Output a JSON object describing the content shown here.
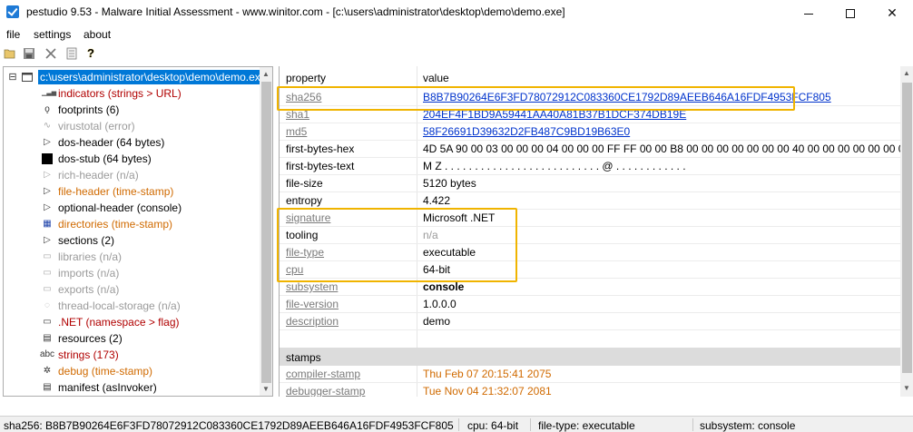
{
  "window": {
    "title": "pestudio 9.53 - Malware Initial Assessment - www.winitor.com - [c:\\users\\administrator\\desktop\\demo\\demo.exe]",
    "controls": {
      "minimize": "—",
      "maximize": "☐",
      "close": "✕"
    }
  },
  "menu": [
    "file",
    "settings",
    "about"
  ],
  "toolbar": {
    "icons": [
      "open-folder-icon",
      "save-icon",
      "close-x-icon",
      "list-icon",
      "help-icon"
    ],
    "help_glyph": "?"
  },
  "tree": {
    "expander": "⊟",
    "root": "c:\\users\\administrator\\desktop\\demo\\demo.exe",
    "items": [
      {
        "label": "indicators (strings > URL)",
        "color": "red",
        "icon": "bar-chart-icon",
        "glyph": "▁▃▅"
      },
      {
        "label": "footprints (6)",
        "color": "black",
        "icon": "footprint-icon",
        "glyph": "ǫ"
      },
      {
        "label": "virustotal (error)",
        "color": "gray",
        "icon": "virustotal-icon",
        "glyph": "∿"
      },
      {
        "label": "dos-header (64 bytes)",
        "color": "black",
        "icon": "arrow-right-icon",
        "glyph": "▷"
      },
      {
        "label": "dos-stub (64 bytes)",
        "color": "black",
        "icon": "console-icon",
        "glyph": "▬"
      },
      {
        "label": "rich-header (n/a)",
        "color": "gray",
        "icon": "arrow-right-icon",
        "glyph": "▷"
      },
      {
        "label": "file-header (time-stamp)",
        "color": "orange",
        "icon": "arrow-right-icon",
        "glyph": "▷"
      },
      {
        "label": "optional-header (console)",
        "color": "black",
        "icon": "arrow-right-icon",
        "glyph": "▷"
      },
      {
        "label": "directories (time-stamp)",
        "color": "orange",
        "icon": "directories-icon",
        "glyph": "▦"
      },
      {
        "label": "sections (2)",
        "color": "black",
        "icon": "arrow-right-icon",
        "glyph": "▷"
      },
      {
        "label": "libraries (n/a)",
        "color": "gray",
        "icon": "library-icon",
        "glyph": "▭"
      },
      {
        "label": "imports (n/a)",
        "color": "gray",
        "icon": "imports-icon",
        "glyph": "▭"
      },
      {
        "label": "exports (n/a)",
        "color": "gray",
        "icon": "exports-icon",
        "glyph": "▭"
      },
      {
        "label": "thread-local-storage (n/a)",
        "color": "gray",
        "icon": "tls-icon",
        "glyph": "◌"
      },
      {
        "label": ".NET (namespace > flag)",
        "color": "red",
        "icon": "dotnet-icon",
        "glyph": "▭"
      },
      {
        "label": "resources (2)",
        "color": "black",
        "icon": "resources-icon",
        "glyph": "▤"
      },
      {
        "label": "strings (173)",
        "color": "red",
        "icon": "strings-icon",
        "glyph": "abc"
      },
      {
        "label": "debug (time-stamp)",
        "color": "orange",
        "icon": "debug-icon",
        "glyph": "✲"
      },
      {
        "label": "manifest (asInvoker)",
        "color": "black",
        "icon": "manifest-icon",
        "glyph": "▤"
      }
    ]
  },
  "properties": {
    "headers": {
      "property": "property",
      "value": "value"
    },
    "rows": [
      {
        "name": "sha256",
        "value": "B8B7B90264E6F3FD78072912C083360CE1792D89AEEB646A16FDF4953FCF805",
        "name_style": "gray-link",
        "value_style": "blue-link"
      },
      {
        "name": "sha1",
        "value": "204EF4F1BD9A59441AA40A81B37B1DCF374DB19E",
        "name_style": "gray-link",
        "value_style": "blue-link"
      },
      {
        "name": "md5",
        "value": "58F26691D39632D2FB487C9BD19B63E0",
        "name_style": "gray-link",
        "value_style": "blue-link"
      },
      {
        "name": "first-bytes-hex",
        "value": "4D 5A 90 00 03 00 00 00 04 00 00 00 FF FF 00 00 B8 00 00 00 00 00 00 00 40 00 00 00 00 00 00 00 00 00",
        "name_style": "plain",
        "value_style": "plain"
      },
      {
        "name": "first-bytes-text",
        "value": "M Z . . . . . . . . . . . . . . . . . . . . . . . . . . @ . . . . . . . . . . . .",
        "name_style": "plain",
        "value_style": "plain"
      },
      {
        "name": "file-size",
        "value": "5120 bytes",
        "name_style": "plain",
        "value_style": "plain"
      },
      {
        "name": "entropy",
        "value": "4.422",
        "name_style": "plain",
        "value_style": "plain"
      },
      {
        "name": "signature",
        "value": "Microsoft .NET",
        "name_style": "gray-link",
        "value_style": "plain"
      },
      {
        "name": "tooling",
        "value": "n/a",
        "name_style": "plain",
        "value_style": "na"
      },
      {
        "name": "file-type",
        "value": "executable",
        "name_style": "gray-link",
        "value_style": "plain"
      },
      {
        "name": "cpu",
        "value": "64-bit",
        "name_style": "gray-link",
        "value_style": "plain"
      },
      {
        "name": "subsystem",
        "value": "console",
        "name_style": "gray-link",
        "value_style": "bold"
      },
      {
        "name": "file-version",
        "value": "1.0.0.0",
        "name_style": "gray-link",
        "value_style": "plain"
      },
      {
        "name": "description",
        "value": "demo",
        "name_style": "gray-link",
        "value_style": "plain"
      }
    ],
    "stamps_header": "stamps",
    "stamps": [
      {
        "name": "compiler-stamp",
        "value": "Thu Feb 07 20:15:41 2075"
      },
      {
        "name": "debugger-stamp",
        "value": "Tue Nov 04 21:32:07 2081"
      }
    ]
  },
  "statusbar": {
    "sha256": "sha256: B8B7B90264E6F3FD78072912C083360CE1792D89AEEB646A16FDF4953FCF805",
    "cpu": "cpu: 64-bit",
    "file_type": "file-type: executable",
    "subsystem": "subsystem: console"
  },
  "colors": {
    "highlight": "#f0b400",
    "selection": "#0078d7",
    "red": "#b00000",
    "orange": "#d06a00",
    "gray": "#9a9a9a",
    "link": "#0033cc"
  }
}
